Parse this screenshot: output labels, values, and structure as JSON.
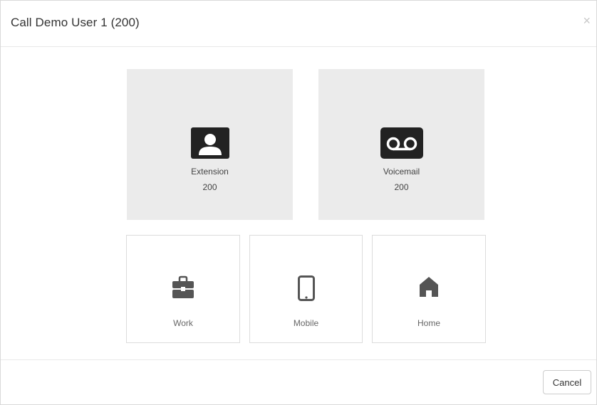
{
  "dialog": {
    "title": "Call Demo User 1 (200)",
    "close_symbol": "×"
  },
  "options": {
    "extension": {
      "label": "Extension",
      "number": "200",
      "icon": "contact-card-icon"
    },
    "voicemail": {
      "label": "Voicemail",
      "number": "200",
      "icon": "voicemail-icon"
    },
    "work": {
      "label": "Work",
      "icon": "briefcase-icon"
    },
    "mobile": {
      "label": "Mobile",
      "icon": "mobile-phone-icon"
    },
    "home": {
      "label": "Home",
      "icon": "house-icon"
    }
  },
  "footer": {
    "cancel_label": "Cancel"
  },
  "colors": {
    "tile_bg": "#ebebeb",
    "icon_dark": "#222222",
    "icon_gray": "#555555"
  }
}
